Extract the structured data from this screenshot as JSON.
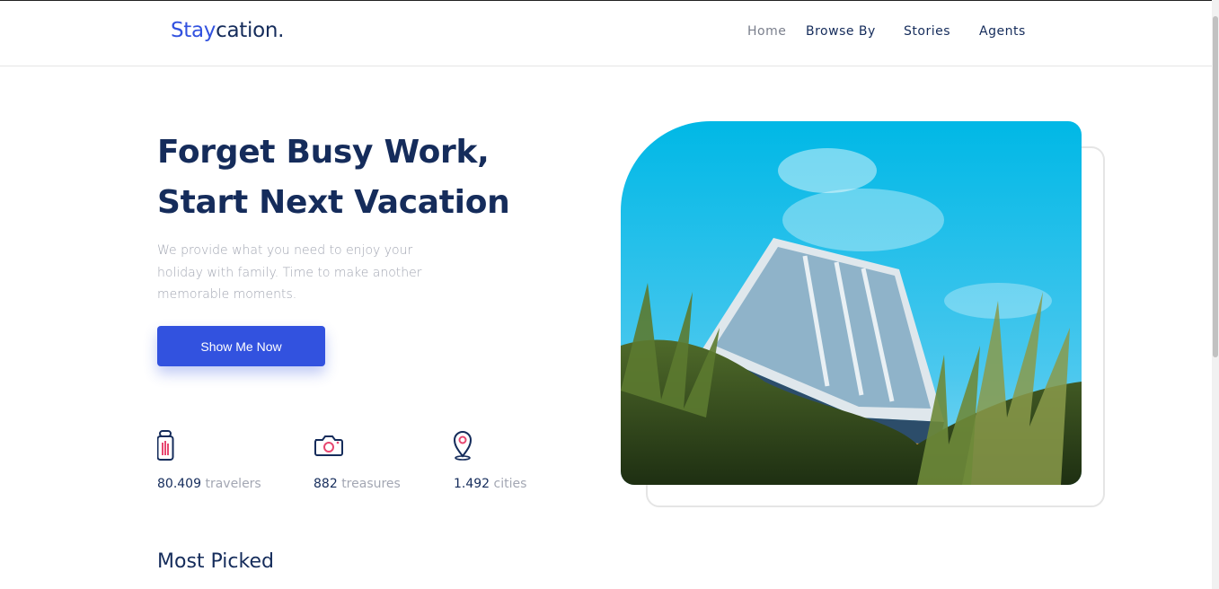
{
  "brand": {
    "accent": "Stay",
    "rest": "cation."
  },
  "nav": {
    "items": [
      {
        "label": "Home"
      },
      {
        "label": "Browse By"
      },
      {
        "label": "Stories"
      },
      {
        "label": "Agents"
      }
    ]
  },
  "hero": {
    "title_line1": "Forget Busy Work,",
    "title_line2": "Start Next Vacation",
    "description": "We provide what you need to enjoy your holiday with family. Time to make another memorable moments.",
    "cta_label": "Show Me Now",
    "image_icon": "cabin-landscape-image"
  },
  "stats": [
    {
      "icon": "luggage-icon",
      "value": "80.409",
      "label": "travelers"
    },
    {
      "icon": "camera-icon",
      "value": "882",
      "label": "treasures"
    },
    {
      "icon": "map-pin-icon",
      "value": "1.492",
      "label": "cities"
    }
  ],
  "sections": {
    "most_picked": "Most Picked"
  },
  "colors": {
    "primary": "#3252df",
    "navy": "#152c5b",
    "muted": "#a3a7b3",
    "accent_pink": "#e74770"
  }
}
